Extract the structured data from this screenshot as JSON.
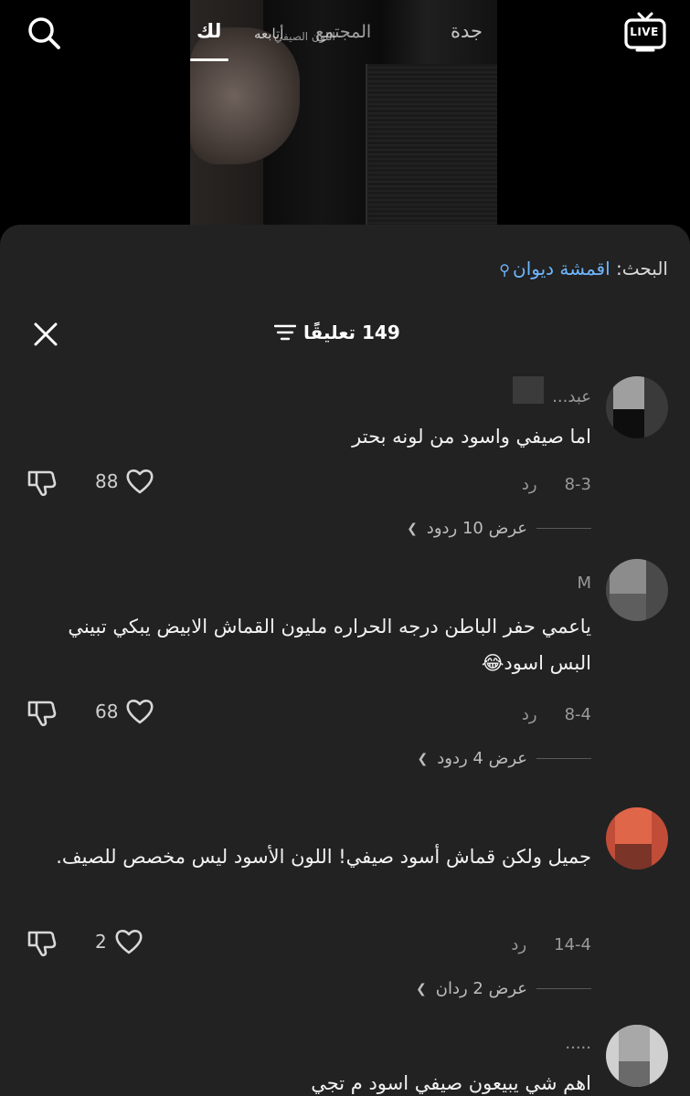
{
  "nav": {
    "tabs": {
      "for_you": "لك",
      "following": "أتابعه",
      "community": "المجتمع",
      "jeddah": "جدة"
    },
    "following_overlay": "اللون الصيفي",
    "live_label": "LIVE",
    "search_icon": "search-icon"
  },
  "search_suggestion": {
    "label": "البحث:",
    "term": "اقمشة ديوان"
  },
  "comments_header": {
    "count_text": "149 تعليقًا"
  },
  "comments": [
    {
      "username": "عبد...",
      "text": "اما صيفي واسود من لونه بحتر",
      "date": "8-3",
      "reply_label": "رد",
      "likes": "88",
      "view_replies": "عرض 10 ردود",
      "avatar_colors": [
        "#9f9f9f",
        "#111111",
        "#3a3a3a"
      ]
    },
    {
      "username": "M",
      "text": "ياعمي حفر الباطن درجه الحراره مليون القماش الابيض يبكي تبيني البس اسود😂",
      "date": "8-4",
      "reply_label": "رد",
      "likes": "68",
      "view_replies": "عرض 4 ردود",
      "avatar_colors": [
        "#8c8c8c",
        "#5e5e5e",
        "#3f3f3f"
      ]
    },
    {
      "username": "",
      "text": "جميل ولكن قماش أسود صيفي! اللون الأسود ليس مخصص للصيف.",
      "date": "14-4",
      "reply_label": "رد",
      "likes": "2",
      "view_replies": "عرض 2 ردان",
      "avatar_colors": [
        "#e0664a",
        "#7a3428",
        "#c14d38"
      ]
    },
    {
      "username": ".....",
      "text": "اهم شي يبيعون صيفي اسود م تجي",
      "avatar_colors": [
        "#a8a8a8",
        "#6a6a6a",
        "#d0d0d0"
      ]
    }
  ]
}
